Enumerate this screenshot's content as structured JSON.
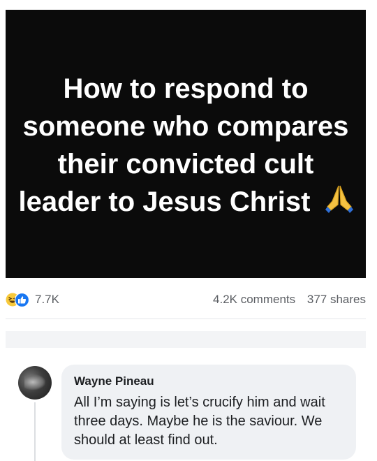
{
  "post": {
    "headline": "How to respond to someone who compares their convicted cult leader to Jesus Christ",
    "headline_icon": "folded-hands-icon"
  },
  "stats": {
    "reaction_icons": [
      "haha-icon",
      "like-icon"
    ],
    "reactions_count": "7.7K",
    "comments": "4.2K comments",
    "shares": "377 shares"
  },
  "comment": {
    "author": "Wayne Pineau",
    "text": "All I’m saying is let’s crucify him and wait three days. Maybe he is the saviour. We should at least find out."
  },
  "colors": {
    "image_bg": "#0b0b0b",
    "headline_text": "#ffffff",
    "like_blue": "#1877f2",
    "haha_yellow": "#f7c93b",
    "bubble_bg": "#eff1f4",
    "meta_text": "#5b5e63"
  }
}
